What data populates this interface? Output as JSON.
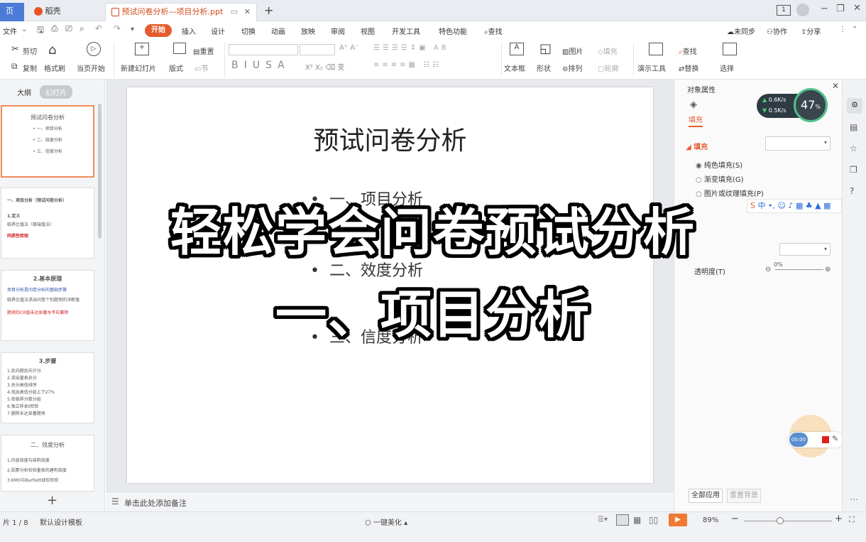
{
  "tabs": {
    "home": "页",
    "wps": "稻壳",
    "doc": "预试问卷分析—项目分析.ppt"
  },
  "menu": {
    "file": "文件",
    "items": [
      "开始",
      "插入",
      "设计",
      "切换",
      "动画",
      "放映",
      "审阅",
      "视图",
      "开发工具",
      "特色功能"
    ],
    "search": "查找",
    "sync": "未同步",
    "collab": "协作",
    "share": "分享"
  },
  "ribbon": {
    "cut": "剪切",
    "copy": "复制",
    "format_painter": "格式刷",
    "from_current": "当页开始",
    "new_slide": "新建幻灯片",
    "layout": "版式",
    "section": "节",
    "reset": "重置",
    "textbox": "文本框",
    "shape": "形状",
    "arrange": "排列",
    "picture": "图片",
    "fill": "填充",
    "outline": "轮廓",
    "present_tools": "演示工具",
    "find": "查找",
    "replace": "替换",
    "select": "选择"
  },
  "left_panel": {
    "outline_tab": "大纲",
    "slides_tab": "幻灯片",
    "add": "+"
  },
  "thumbnails": [
    {
      "title": "预试问卷分析",
      "lines": [
        "• 一、项目分析",
        "• 二、效度分析",
        "• 三、信度分析"
      ]
    },
    {
      "title": "一、项目分析（预试问卷分析）",
      "lines": [
        "1.定义",
        "临界比值法（极端值法）",
        "同质性检验"
      ]
    },
    {
      "title": "2.基本原理",
      "lines": [
        "项目分析是问卷分析的基础步骤",
        "临界比值法求出问卷个别题项的决断值",
        "题项的CR值未达显著水平应删除"
      ]
    },
    {
      "title": "3.步骤",
      "lines": [
        "1.反向题反向计分",
        "2.求出量表总分",
        "3.总分高低排序",
        "4.找出高低分组上下27%",
        "5.依临界分数分组",
        "6.独立样本t检验",
        "7.删除未达显著题项"
      ]
    },
    {
      "title": "二、效度分析",
      "lines": [
        "1.内容效度与结构效度",
        "2.因素分析检验量表的建构效度",
        "3.KMO与Bartlett球形检验"
      ]
    }
  ],
  "slide": {
    "title": "预试问卷分析",
    "bullets": [
      "一、项目分析",
      "二、效度分析",
      "三、信度分析"
    ]
  },
  "notes_placeholder": "单击此处添加备注",
  "overlay": {
    "line1": "轻松学会问卷预试分析",
    "line2": "一、项目分析"
  },
  "right_panel": {
    "title": "对象属性",
    "fill_tab": "填充",
    "fill_section": "填充",
    "options": [
      "纯色填充(S)",
      "渐变填充(G)",
      "图片或纹理填充(P)"
    ],
    "transparency_label": "透明度(T)",
    "transparency_value": "0%",
    "apply_all": "全部应用",
    "reset_bg": "重置背景",
    "net_up": "0.6K/s",
    "net_down": "0.5K/s",
    "cpu": "47",
    "cpu_unit": "%",
    "recorder_time": "00:00"
  },
  "status": {
    "slide_count": "片 1 / 8",
    "template": "默认设计模板",
    "beautify": "一键美化",
    "zoom": "89%"
  },
  "colors": {
    "accent": "#e45c2e",
    "selected_thumb": "#f08d5c"
  }
}
